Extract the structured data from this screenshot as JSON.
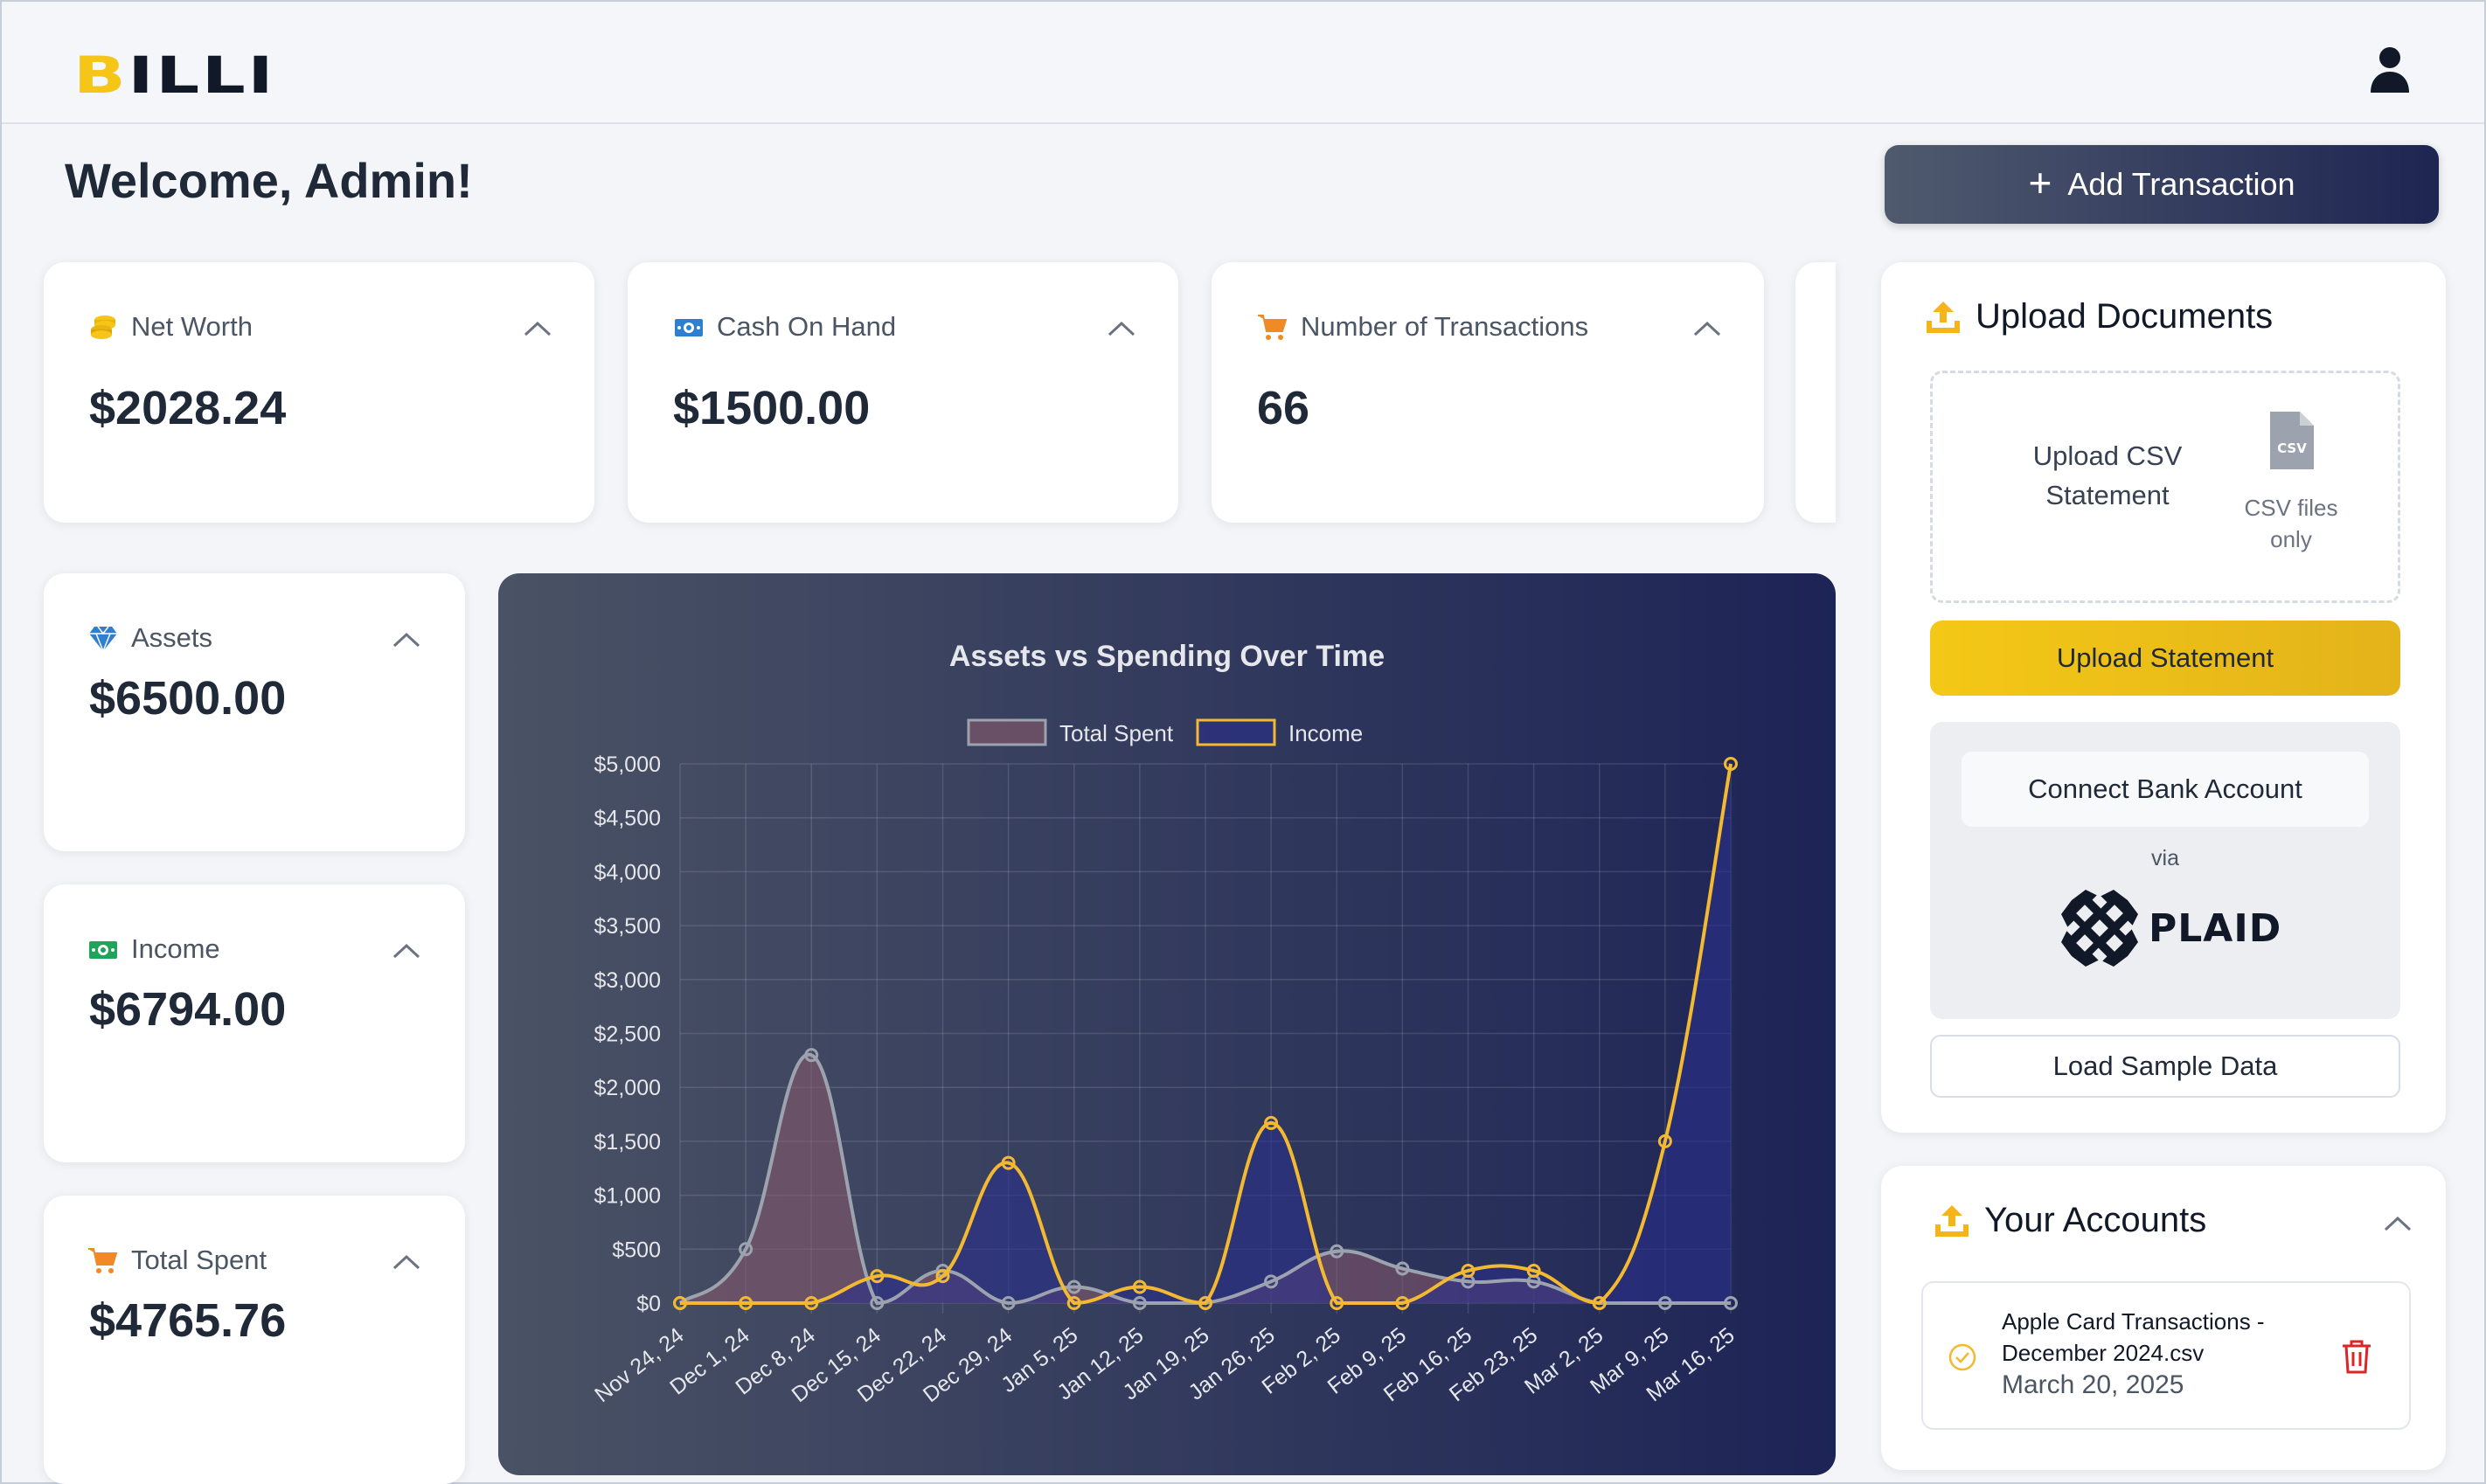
{
  "app": {
    "logo_first": "B",
    "logo_rest": "ILLI",
    "accent_color": "#f5c518",
    "user_icon": "user-icon"
  },
  "header": {
    "welcome": "Welcome, Admin!",
    "add_transaction": "Add Transaction"
  },
  "stats_top": [
    {
      "label": "Net Worth",
      "value": "$2028.24",
      "icon": "coins-icon"
    },
    {
      "label": "Cash On Hand",
      "value": "$1500.00",
      "icon": "cash-icon"
    },
    {
      "label": "Number of Transactions",
      "value": "66",
      "icon": "cart-icon"
    }
  ],
  "stats_side": [
    {
      "label": "Assets",
      "value": "$6500.00",
      "icon": "diamond-icon"
    },
    {
      "label": "Income",
      "value": "$6794.00",
      "icon": "money-icon"
    },
    {
      "label": "Total Spent",
      "value": "$4765.76",
      "icon": "cart-icon"
    }
  ],
  "upload": {
    "title": "Upload Documents",
    "drop_text": "Upload CSV Statement",
    "file_hint": "CSV files only",
    "csv_badge": "CSV",
    "upload_button": "Upload Statement",
    "connect_button": "Connect Bank Account",
    "via": "via",
    "plaid": "PLAID",
    "sample_button": "Load Sample Data"
  },
  "accounts": {
    "title": "Your Accounts",
    "items": [
      {
        "name": "Apple Card Transactions - December 2024.csv",
        "date": "March 20, 2025"
      }
    ]
  },
  "chart_data": {
    "type": "line",
    "title": "Assets vs Spending Over Time",
    "xlabel": "",
    "ylabel": "",
    "ylim": [
      0,
      5000
    ],
    "yticks": [
      "$0",
      "$500",
      "$1,000",
      "$1,500",
      "$2,000",
      "$2,500",
      "$3,000",
      "$3,500",
      "$4,000",
      "$4,500",
      "$5,000"
    ],
    "categories": [
      "Nov 24, 24",
      "Dec 1, 24",
      "Dec 8, 24",
      "Dec 15, 24",
      "Dec 22, 24",
      "Dec 29, 24",
      "Jan 5, 25",
      "Jan 12, 25",
      "Jan 19, 25",
      "Jan 26, 25",
      "Feb 2, 25",
      "Feb 9, 25",
      "Feb 16, 25",
      "Feb 23, 25",
      "Mar 2, 25",
      "Mar 9, 25",
      "Mar 16, 25"
    ],
    "series": [
      {
        "name": "Total Spent",
        "color": "#9ca3af",
        "fill": "#8b5a6b",
        "values": [
          0,
          500,
          2300,
          0,
          300,
          0,
          150,
          0,
          0,
          200,
          480,
          320,
          200,
          200,
          0,
          0,
          0
        ]
      },
      {
        "name": "Income",
        "color": "#f2b931",
        "fill": "#2a2f8a",
        "values": [
          0,
          0,
          0,
          250,
          250,
          1300,
          0,
          150,
          0,
          1670,
          0,
          0,
          300,
          300,
          0,
          1500,
          5000
        ]
      }
    ],
    "grid": true,
    "legend": "top"
  }
}
